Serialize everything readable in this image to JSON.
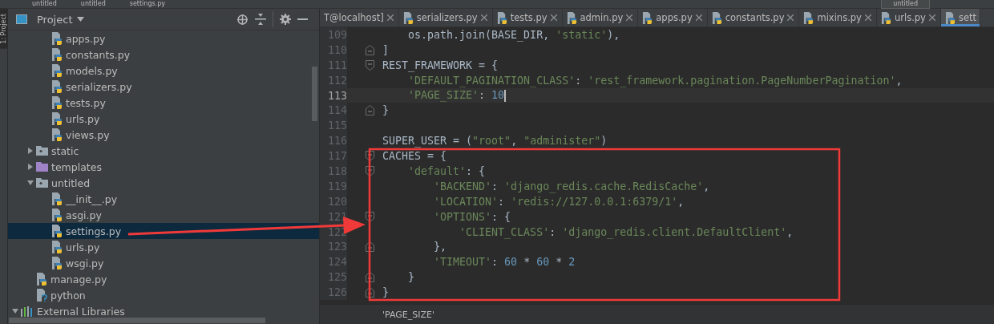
{
  "breadcrumbs": [
    "untitled",
    "untitled",
    "settings.py"
  ],
  "run_config": "untitled",
  "tool_strip": {
    "label": "1: Project"
  },
  "project_panel": {
    "title": "Project",
    "tree": [
      {
        "children": [
          {
            "children": [
              {
                "label": "apps.py",
                "kind": "py",
                "selected": false
              },
              {
                "label": "constants.py",
                "kind": "py",
                "selected": false
              },
              {
                "label": "models.py",
                "kind": "py",
                "selected": false
              },
              {
                "label": "serializers.py",
                "kind": "py",
                "selected": false
              },
              {
                "label": "tests.py",
                "kind": "py",
                "selected": false
              },
              {
                "label": "urls.py",
                "kind": "py",
                "selected": false
              },
              {
                "label": "views.py",
                "kind": "py",
                "selected": false
              }
            ]
          },
          {
            "label": "static",
            "kind": "folder",
            "expanded": false,
            "selected": false
          },
          {
            "label": "templates",
            "kind": "templates",
            "expanded": false,
            "selected": false
          },
          {
            "label": "untitled",
            "kind": "folder",
            "expanded": true,
            "selected": false,
            "children": [
              {
                "label": "__init__.py",
                "kind": "py",
                "selected": false
              },
              {
                "label": "asgi.py",
                "kind": "py",
                "selected": false
              },
              {
                "label": "settings.py",
                "kind": "py",
                "selected": true
              },
              {
                "label": "urls.py",
                "kind": "py",
                "selected": false
              },
              {
                "label": "wsgi.py",
                "kind": "py",
                "selected": false
              }
            ]
          },
          {
            "label": "manage.py",
            "kind": "py",
            "selected": false
          },
          {
            "label": "python",
            "kind": "unknown",
            "selected": false
          }
        ]
      },
      {
        "label": "External Libraries",
        "kind": "library",
        "expanded": true,
        "selected": false
      }
    ]
  },
  "tabs": [
    {
      "label": "T@localhost]",
      "kind": "db",
      "selected": false
    },
    {
      "label": "serializers.py",
      "kind": "py",
      "selected": false
    },
    {
      "label": "tests.py",
      "kind": "py",
      "selected": false
    },
    {
      "label": "admin.py",
      "kind": "py",
      "selected": false
    },
    {
      "label": "apps.py",
      "kind": "py",
      "selected": false
    },
    {
      "label": "constants.py",
      "kind": "py",
      "selected": false
    },
    {
      "label": "mixins.py",
      "kind": "py",
      "selected": false
    },
    {
      "label": "urls.py",
      "kind": "py",
      "selected": false
    },
    {
      "label": "sett",
      "kind": "py",
      "selected": true
    }
  ],
  "code": [
    {
      "n": "109",
      "tokens": [
        {
          "t": "    os.path.join(BASE_DIR, "
        },
        {
          "t": "'static'",
          "color": "#6a8759"
        },
        {
          "t": "),"
        }
      ]
    },
    {
      "n": "110",
      "fold_end": true,
      "tokens": [
        {
          "t": "]"
        }
      ]
    },
    {
      "n": "111",
      "fold_start": true,
      "tokens": [
        {
          "t": "REST_FRAMEWORK = {"
        }
      ]
    },
    {
      "n": "112",
      "tokens": [
        {
          "t": "    'DEFAULT_PAGINATION_CLASS'",
          "color": "#6a8759"
        },
        {
          "t": ": "
        },
        {
          "t": "'rest_framework.pagination.PageNumberPagination'",
          "color": "#6a8759"
        },
        {
          "t": ","
        }
      ]
    },
    {
      "n": "113",
      "current": true,
      "tokens": [
        {
          "t": "    'PAGE_SIZE'",
          "color": "#6a8759"
        },
        {
          "t": ": "
        },
        {
          "t": "10",
          "color": "#6897bb"
        }
      ]
    },
    {
      "n": "114",
      "fold_end": true,
      "tokens": [
        {
          "t": "}"
        }
      ]
    },
    {
      "n": "115"
    },
    {
      "n": "116",
      "tokens": [
        {
          "t": "SUPER_USER = ("
        },
        {
          "t": "\"root\"",
          "color": "#6a8759"
        },
        {
          "t": ", "
        },
        {
          "t": "\"administer\"",
          "color": "#6a8759"
        },
        {
          "t": ")"
        }
      ]
    },
    {
      "n": "117",
      "fold_start": true,
      "tokens": [
        {
          "t": "CACHES = {"
        }
      ]
    },
    {
      "n": "118",
      "fold_start": true,
      "tokens": [
        {
          "t": "    'default'",
          "color": "#6a8759"
        },
        {
          "t": ": {"
        }
      ]
    },
    {
      "n": "119",
      "tokens": [
        {
          "t": "        'BACKEND'",
          "color": "#6a8759"
        },
        {
          "t": ": "
        },
        {
          "t": "'django_redis.cache.RedisCache'",
          "color": "#6a8759"
        },
        {
          "t": ","
        }
      ]
    },
    {
      "n": "120",
      "tokens": [
        {
          "t": "        'LOCATION'",
          "color": "#6a8759"
        },
        {
          "t": ": "
        },
        {
          "t": "'redis://127.0.0.1:6379/1'",
          "color": "#6a8759"
        },
        {
          "t": ","
        }
      ]
    },
    {
      "n": "121",
      "fold_start": true,
      "tokens": [
        {
          "t": "        'OPTIONS'",
          "color": "#6a8759"
        },
        {
          "t": ": {"
        }
      ]
    },
    {
      "n": "122",
      "tokens": [
        {
          "t": "            'CLIENT_CLASS'",
          "color": "#6a8759"
        },
        {
          "t": ": "
        },
        {
          "t": "'django_redis.client.DefaultClient'",
          "color": "#6a8759"
        },
        {
          "t": ","
        }
      ]
    },
    {
      "n": "123",
      "fold_end": true,
      "tokens": [
        {
          "t": "        },"
        }
      ]
    },
    {
      "n": "124",
      "tokens": [
        {
          "t": "        'TIMEOUT'",
          "color": "#6a8759"
        },
        {
          "t": ": "
        },
        {
          "t": "60",
          "color": "#6897bb"
        },
        {
          "t": " * "
        },
        {
          "t": "60",
          "color": "#6897bb"
        },
        {
          "t": " * "
        },
        {
          "t": "2",
          "color": "#6897bb"
        }
      ]
    },
    {
      "n": "125",
      "fold_end": true,
      "tokens": [
        {
          "t": "    }"
        }
      ]
    },
    {
      "n": "126",
      "fold_end": true,
      "tokens": [
        {
          "t": "}"
        }
      ]
    }
  ],
  "status_breadcrumb": "'PAGE_SIZE'"
}
